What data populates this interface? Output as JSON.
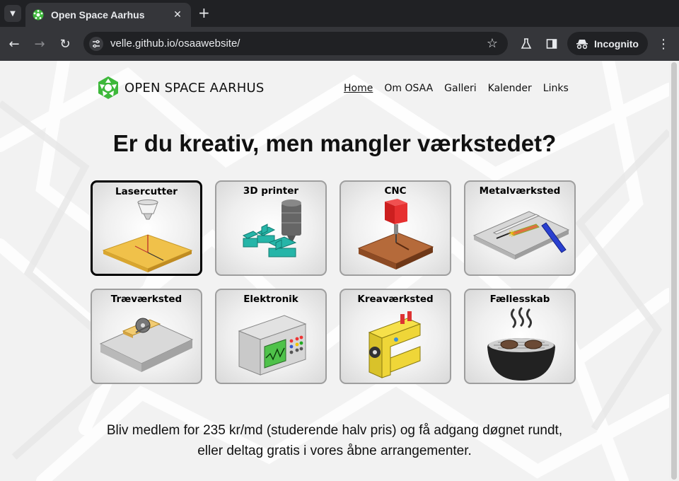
{
  "browser": {
    "tab_title": "Open Space Aarhus",
    "url": "velle.github.io/osaawebsite/",
    "incognito_label": "Incognito",
    "icons": {
      "tab_list": "chevron-down-icon",
      "close": "close-icon",
      "new_tab": "plus-icon",
      "back": "back-arrow-icon",
      "forward": "forward-arrow-icon",
      "reload": "reload-icon",
      "site_info": "site-info-icon",
      "bookmark": "star-icon",
      "labs": "flask-icon",
      "side_panel": "side-panel-icon",
      "menu": "kebab-menu-icon"
    }
  },
  "site": {
    "logo_text": "OPEN SPACE AARHUS",
    "brand_color": "#3db83a",
    "nav": [
      {
        "label": "Home",
        "active": true
      },
      {
        "label": "Om OSAA",
        "active": false
      },
      {
        "label": "Galleri",
        "active": false
      },
      {
        "label": "Kalender",
        "active": false
      },
      {
        "label": "Links",
        "active": false
      }
    ],
    "hero_title": "Er du kreativ, men mangler værkstedet?",
    "cards": [
      {
        "label": "Lasercutter",
        "icon": "lasercutter-icon",
        "selected": true
      },
      {
        "label": "3D printer",
        "icon": "3d-printer-icon",
        "selected": false
      },
      {
        "label": "CNC",
        "icon": "cnc-icon",
        "selected": false
      },
      {
        "label": "Metalværksted",
        "icon": "welding-icon",
        "selected": false
      },
      {
        "label": "Træværksted",
        "icon": "table-saw-icon",
        "selected": false
      },
      {
        "label": "Elektronik",
        "icon": "oscilloscope-icon",
        "selected": false
      },
      {
        "label": "Kreaværksted",
        "icon": "sewing-machine-icon",
        "selected": false
      },
      {
        "label": "Fællesskab",
        "icon": "grill-icon",
        "selected": false
      }
    ],
    "footer_line1": "Bliv medlem for 235 kr/md (studerende halv pris) og få adgang døgnet rundt,",
    "footer_line2": "eller deltag gratis i vores åbne arrangementer."
  }
}
